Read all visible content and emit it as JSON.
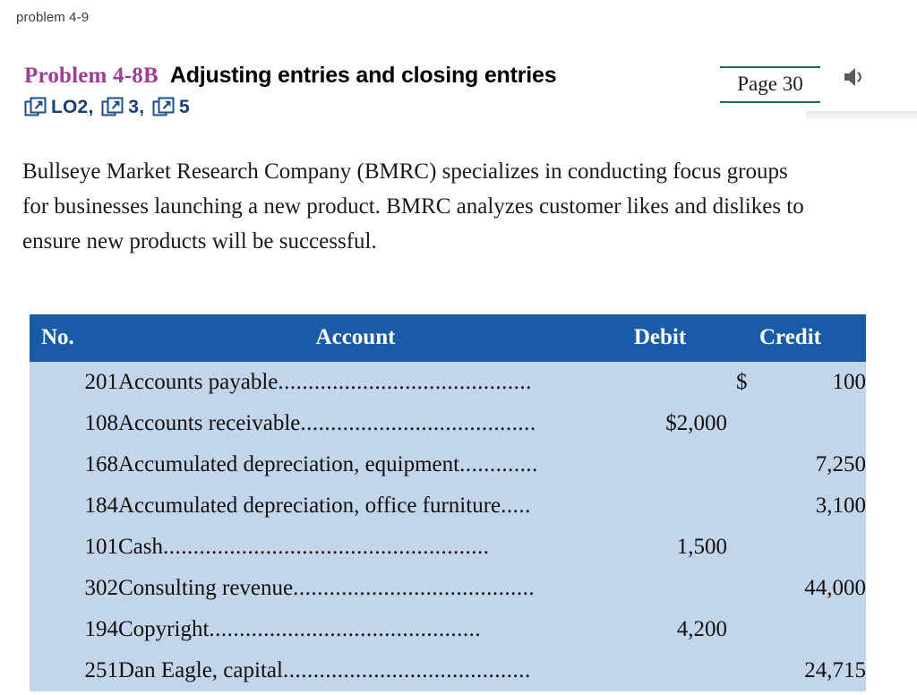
{
  "doc_label": "problem 4-9",
  "heading": {
    "problem_number": "Problem 4-8B",
    "title": "Adjusting entries and closing entries",
    "learning_objectives": [
      {
        "icon": "external-link-icon",
        "label": "LO2",
        "separator": ","
      },
      {
        "icon": "external-link-icon",
        "label": "3",
        "separator": ","
      },
      {
        "icon": "external-link-icon",
        "label": "5",
        "separator": ""
      }
    ]
  },
  "page_badge": {
    "text": "Page 30",
    "rule_color": "#1d6b3e"
  },
  "overlay": {
    "speaker_icon": "speaker-volume-icon"
  },
  "intro_paragraph": "Bullseye Market Research Company (BMRC) specializes in conducting focus groups for businesses launching a new product. BMRC analyzes customer likes and dislikes to ensure new products will be successful.",
  "table": {
    "header_bg": "#1a5ba8",
    "row_bg": "#c3d5ea",
    "columns": [
      "No.",
      "Account",
      "Debit",
      "Credit"
    ],
    "rows": [
      {
        "no": "201",
        "account": "Accounts payable",
        "dots": "..........................................",
        "debit": "",
        "credit_symbol": "$",
        "credit": "100"
      },
      {
        "no": "108",
        "account": "Accounts receivable",
        "dots": ".......................................",
        "debit": "$2,000",
        "credit_symbol": "",
        "credit": ""
      },
      {
        "no": "168",
        "account": "Accumulated depreciation, equipment",
        "dots": ".............",
        "debit": "",
        "credit_symbol": "",
        "credit": "7,250"
      },
      {
        "no": "184",
        "account": "Accumulated depreciation, office furniture",
        "dots": ".....",
        "debit": "",
        "credit_symbol": "",
        "credit": "3,100"
      },
      {
        "no": "101",
        "account": "Cash",
        "dots": "......................................................",
        "debit": "1,500",
        "credit_symbol": "",
        "credit": ""
      },
      {
        "no": "302",
        "account": "Consulting revenue",
        "dots": "........................................",
        "debit": "",
        "credit_symbol": "",
        "credit": "44,000"
      },
      {
        "no": "194",
        "account": "Copyright",
        "dots": ".............................................",
        "debit": "4,200",
        "credit_symbol": "",
        "credit": ""
      },
      {
        "no": "251",
        "account": "Dan Eagle, capital",
        "dots": ".........................................",
        "debit": "",
        "credit_symbol": "",
        "credit": "24,715"
      }
    ]
  }
}
